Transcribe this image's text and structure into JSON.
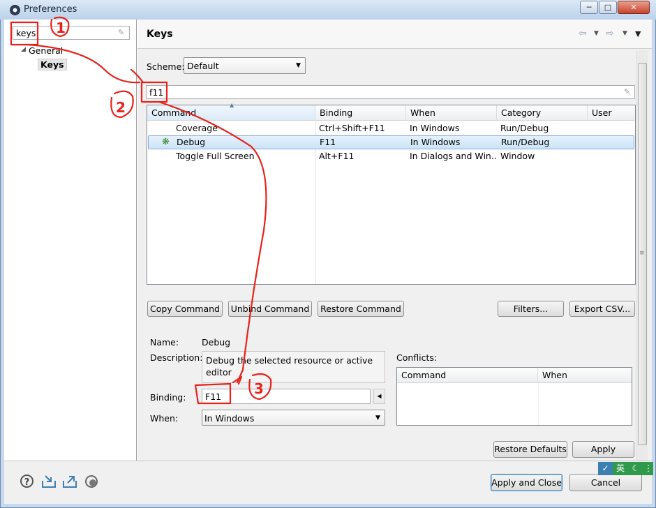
{
  "window": {
    "title": "Preferences",
    "minimize": "─",
    "maximize": "□",
    "close": "✕"
  },
  "left": {
    "filter_value": "keys",
    "tree": {
      "root": "General",
      "child": "Keys"
    }
  },
  "page": {
    "title": "Keys",
    "scheme_label": "Scheme:",
    "scheme_value": "Default",
    "filter_value": "f11"
  },
  "table": {
    "columns": [
      "Command",
      "Binding",
      "When",
      "Category",
      "User"
    ],
    "rows": [
      {
        "command": "Coverage",
        "binding": "Ctrl+Shift+F11",
        "when": "In Windows",
        "category": "Run/Debug",
        "user": ""
      },
      {
        "command": "Debug",
        "binding": "F11",
        "when": "In Windows",
        "category": "Run/Debug",
        "user": ""
      },
      {
        "command": "Toggle Full Screen",
        "binding": "Alt+F11",
        "when": "In Dialogs and Win...",
        "category": "Window",
        "user": ""
      }
    ]
  },
  "actions": {
    "copy": "Copy Command",
    "unbind": "Unbind Command",
    "restore": "Restore Command",
    "filters": "Filters...",
    "export": "Export CSV..."
  },
  "details": {
    "name_label": "Name:",
    "name_value": "Debug",
    "description_label": "Description:",
    "description_value": "Debug the selected resource or active editor",
    "binding_label": "Binding:",
    "binding_value": "F11",
    "when_label": "When:",
    "when_value": "In Windows"
  },
  "conflicts": {
    "label": "Conflicts:",
    "columns": [
      "Command",
      "When"
    ]
  },
  "footer": {
    "restore_defaults": "Restore Defaults",
    "apply": "Apply",
    "apply_close": "Apply and Close",
    "cancel": "Cancel"
  },
  "tray": {
    "ime": "英"
  },
  "annotations": {
    "one": "1",
    "two": "2",
    "three": "3"
  },
  "colors": {
    "annotation": "#e8221b",
    "selection": "#cce4f7",
    "accent": "#3c7fb1"
  }
}
